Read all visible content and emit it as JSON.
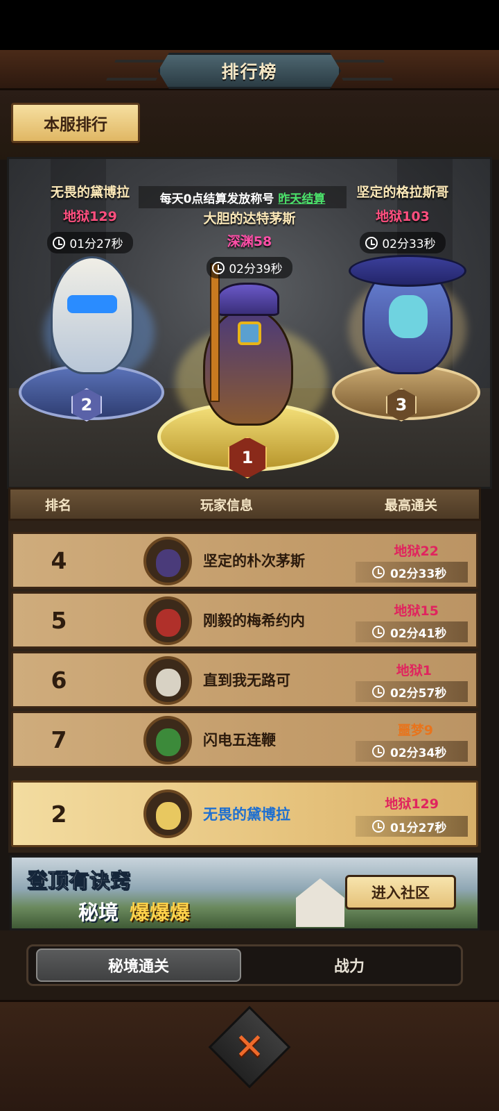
{
  "header": {
    "title": "排行榜"
  },
  "tabs": {
    "server_rank": "本服排行"
  },
  "notice": {
    "text": "每天0点结算发放称号",
    "link": "昨天结算"
  },
  "podium": [
    {
      "rank": "1",
      "name": "大胆的达特茅斯",
      "level": "深渊58",
      "time": "02分39秒",
      "level_color": "#ff4fa8"
    },
    {
      "rank": "2",
      "name": "无畏的黛博拉",
      "level": "地狱129",
      "time": "01分27秒",
      "level_color": "#ff4f7f"
    },
    {
      "rank": "3",
      "name": "坚定的格拉斯哥",
      "level": "地狱103",
      "time": "02分33秒",
      "level_color": "#ff4f7f"
    }
  ],
  "list_header": {
    "rank": "排名",
    "player": "玩家信息",
    "best": "最高通关"
  },
  "rows": [
    {
      "rank": "4",
      "name": "坚定的朴次茅斯",
      "level": "地狱22",
      "time": "02分33秒",
      "avatar_color": "#4a3b7a",
      "level_color": "#e0245e"
    },
    {
      "rank": "5",
      "name": "刚毅的梅希约内",
      "level": "地狱15",
      "time": "02分41秒",
      "avatar_color": "#b0302a",
      "level_color": "#e0245e"
    },
    {
      "rank": "6",
      "name": "直到我无路可",
      "level": "地狱1",
      "time": "02分57秒",
      "avatar_color": "#d8d2c4",
      "level_color": "#e0245e"
    },
    {
      "rank": "7",
      "name": "闪电五连鞭",
      "level": "噩梦9",
      "time": "02分34秒",
      "avatar_color": "#3c8a3a",
      "level_color": "#e8741c"
    }
  ],
  "me": {
    "rank": "2",
    "name": "无畏的黛博拉",
    "level": "地狱129",
    "time": "01分27秒",
    "avatar_color": "#e8c860"
  },
  "banner": {
    "line1": "登顶有诀窍",
    "line2a": "秘境",
    "line2b": "爆爆爆",
    "button": "进入社区"
  },
  "bottom_tabs": {
    "active": "秘境通关",
    "inactive": "战力"
  },
  "icons": {
    "clock": "clock-icon",
    "close": "close-icon"
  },
  "colors": {
    "accent_gold": "#e6c37d",
    "level_pink": "#e0245e",
    "close_orange": "#f06a2a"
  }
}
